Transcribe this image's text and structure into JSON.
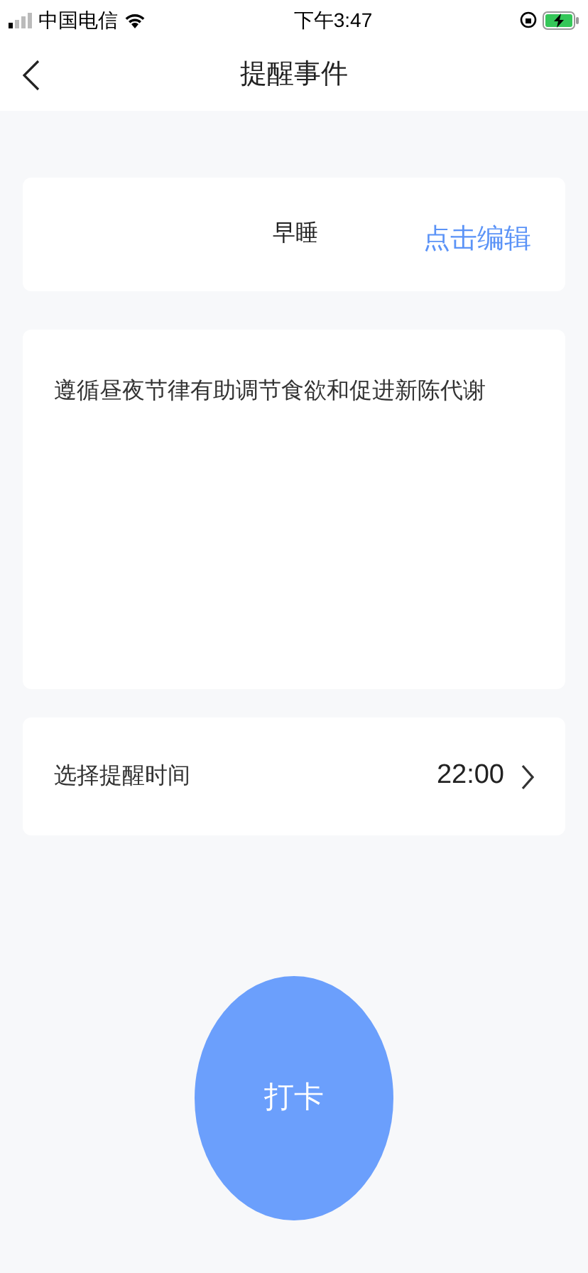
{
  "status_bar": {
    "carrier": "中国电信",
    "time": "下午3:47"
  },
  "nav": {
    "title": "提醒事件"
  },
  "event": {
    "name": "早睡",
    "edit_link": "点击编辑"
  },
  "description": "遵循昼夜节律有助调节食欲和促进新陈代谢",
  "reminder": {
    "label": "选择提醒时间",
    "value": "22:00"
  },
  "check_in_button": "打卡"
}
